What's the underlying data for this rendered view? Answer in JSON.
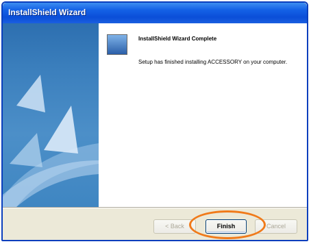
{
  "window": {
    "title": "InstallShield Wizard"
  },
  "content": {
    "heading": "InstallShield Wizard Complete",
    "message": "Setup has finished installing ACCESSORY on your computer."
  },
  "buttons": {
    "back": "< Back",
    "finish": "Finish",
    "cancel": "Cancel"
  },
  "colors": {
    "titlebar": "#0b4ed8",
    "highlight": "#f07a1a",
    "sidepanel": "#3b7fbd"
  }
}
